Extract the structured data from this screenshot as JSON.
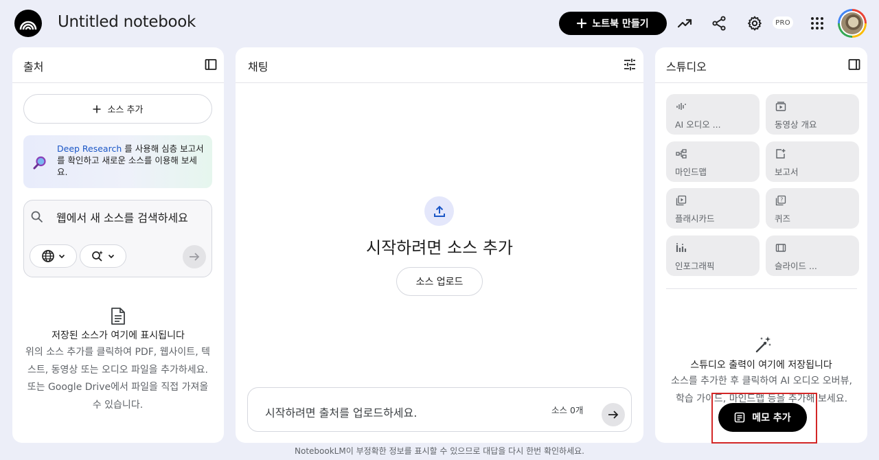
{
  "header": {
    "title": "Untitled notebook",
    "create_label": "노트북 만들기",
    "pro_badge": "PRO"
  },
  "sources": {
    "title": "출처",
    "add_label": "소스 추가",
    "deep_research": {
      "link": "Deep Research",
      "text": " 를 사용해 심층 보고서를 확인하고 새로운 소스를 이용해 보세요."
    },
    "search_text": "웹에서 새 소스를 검색하세요",
    "empty_title": "저장된 소스가 여기에 표시됩니다",
    "empty_desc": "위의 소스 추가를 클릭하여 PDF, 웹사이트, 텍스트, 동영상 또는 오디오 파일을 추가하세요. 또는 Google Drive에서 파일을 직접 가져올 수 있습니다."
  },
  "chat": {
    "title": "채팅",
    "heading": "시작하려면 소스 추가",
    "upload_label": "소스 업로드",
    "input_placeholder": "시작하려면 출처를 업로드하세요.",
    "source_count": "소스 0개"
  },
  "studio": {
    "title": "스튜디오",
    "tiles": [
      {
        "label": "AI 오디오 ...",
        "icon": "audio-icon"
      },
      {
        "label": "동영상 개요",
        "icon": "video-icon"
      },
      {
        "label": "마인드맵",
        "icon": "mindmap-icon"
      },
      {
        "label": "보고서",
        "icon": "report-icon"
      },
      {
        "label": "플래시카드",
        "icon": "flashcard-icon"
      },
      {
        "label": "퀴즈",
        "icon": "quiz-icon"
      },
      {
        "label": "인포그래픽",
        "icon": "infographic-icon"
      },
      {
        "label": "슬라이드 ...",
        "icon": "slides-icon"
      }
    ],
    "empty_title": "스튜디오 출력이 여기에 저장됩니다",
    "empty_desc": "소스를 추가한 후 클릭하여 AI 오디오 오버뷰, 학습 가이드, 마인드맵 등을 추가해 보세요.",
    "memo_label": "메모 추가"
  },
  "footer": "NotebookLM이 부정확한 정보를 표시할 수 있으므로 대답을 다시 한번 확인하세요.",
  "colors": {
    "background": "#eceef8",
    "accent_link": "#1a56c6",
    "highlight_box": "#d32626"
  }
}
